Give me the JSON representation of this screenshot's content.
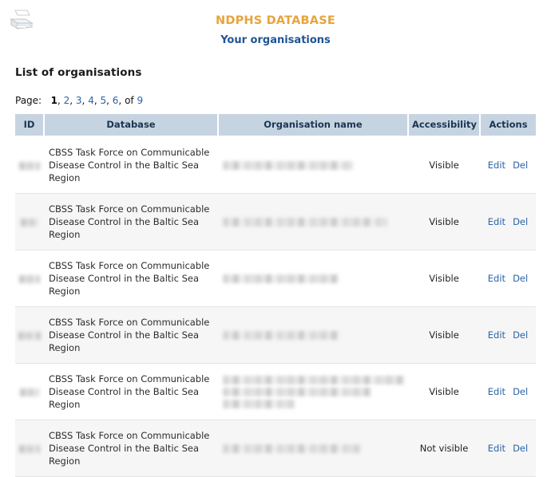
{
  "header": {
    "printer_icon": "printer-icon",
    "database_title": "NDPHS DATABASE",
    "page_subtitle": "Your organisations"
  },
  "section": {
    "heading": "List of organisations"
  },
  "pager": {
    "label": "Page:",
    "pages": [
      "1",
      "2",
      "3",
      "4",
      "5",
      "6"
    ],
    "current_page": "1",
    "of_label": "of",
    "total_pages": "9",
    "comma": ","
  },
  "table": {
    "columns": [
      {
        "key": "id",
        "label": "ID"
      },
      {
        "key": "database",
        "label": "Database"
      },
      {
        "key": "organisation_name",
        "label": "Organisation name"
      },
      {
        "key": "accessibility",
        "label": "Accessibility"
      },
      {
        "key": "actions",
        "label": "Actions"
      }
    ],
    "actions": {
      "edit_label": "Edit",
      "delete_label": "Del"
    },
    "rows": [
      {
        "id": "",
        "id_redacted": true,
        "id_blur_width": 26,
        "database": "CBSS Task Force on Communicable Disease Control in the Baltic Sea Region",
        "organisation_name": "",
        "name_redacted": true,
        "name_blur_widths": [
          163
        ],
        "accessibility": "Visible",
        "edit": "Edit",
        "delete": "Del"
      },
      {
        "id": "",
        "id_redacted": true,
        "id_blur_width": 22,
        "database": "CBSS Task Force on Communicable Disease Control in the Baltic Sea Region",
        "organisation_name": "",
        "name_redacted": true,
        "name_blur_widths": [
          206
        ],
        "accessibility": "Visible",
        "edit": "Edit",
        "delete": "Del"
      },
      {
        "id": "",
        "id_redacted": true,
        "id_blur_width": 26,
        "database": "CBSS Task Force on Communicable Disease Control in the Baltic Sea Region",
        "organisation_name": "",
        "name_redacted": true,
        "name_blur_widths": [
          145
        ],
        "accessibility": "Visible",
        "edit": "Edit",
        "delete": "Del"
      },
      {
        "id": "",
        "id_redacted": true,
        "id_blur_width": 28,
        "database": "CBSS Task Force on Communicable Disease Control in the Baltic Sea Region",
        "organisation_name": "",
        "name_redacted": true,
        "name_blur_widths": [
          146
        ],
        "accessibility": "Visible",
        "edit": "Edit",
        "delete": "Del"
      },
      {
        "id": "",
        "id_redacted": true,
        "id_blur_width": 24,
        "database": "CBSS Task Force on Communicable Disease Control in the Baltic Sea Region",
        "organisation_name": "",
        "name_redacted": true,
        "name_blur_widths": [
          228,
          186,
          90
        ],
        "accessibility": "Visible",
        "edit": "Edit",
        "delete": "Del"
      },
      {
        "id": "",
        "id_redacted": true,
        "id_blur_width": 26,
        "database": "CBSS Task Force on Communicable Disease Control in the Baltic Sea Region",
        "organisation_name": "",
        "name_redacted": true,
        "name_blur_widths": [
          173
        ],
        "accessibility": "Not visible",
        "edit": "Edit",
        "delete": "Del"
      }
    ]
  },
  "colors": {
    "title_orange": "#E9A33C",
    "subtitle_blue": "#1F5495",
    "link_blue": "#2A63A8",
    "header_bg": "#C6D4E1",
    "row_alt_bg": "#F6F6F6"
  }
}
